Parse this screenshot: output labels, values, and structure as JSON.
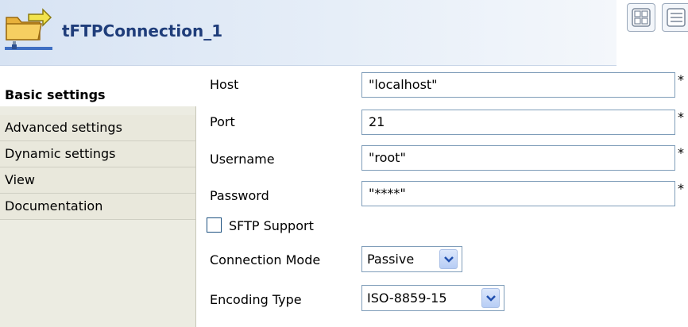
{
  "header": {
    "title": "tFTPConnection_1",
    "icon": "ftp-connection-folder-icon",
    "layout_buttons": [
      "grid-layout-icon",
      "list-layout-icon"
    ]
  },
  "sidebar": {
    "items": [
      {
        "label": "Basic settings",
        "active": true
      },
      {
        "label": "Advanced settings",
        "active": false
      },
      {
        "label": "Dynamic settings",
        "active": false
      },
      {
        "label": "View",
        "active": false
      },
      {
        "label": "Documentation",
        "active": false
      }
    ]
  },
  "form": {
    "host": {
      "label": "Host",
      "value": "\"localhost\"",
      "required_mark": "*"
    },
    "port": {
      "label": "Port",
      "value": "21",
      "required_mark": "*"
    },
    "username": {
      "label": "Username",
      "value": "\"root\"",
      "required_mark": "*"
    },
    "password": {
      "label": "Password",
      "value": "\"****\"",
      "required_mark": "*"
    },
    "sftp_support": {
      "label": "SFTP Support",
      "checked": false
    },
    "connection_mode": {
      "label": "Connection Mode",
      "value": "Passive"
    },
    "encoding_type": {
      "label": "Encoding Type",
      "value": "ISO-8859-15"
    }
  },
  "colors": {
    "header_title": "#1f3d7a",
    "sidebar_bg": "#ecece2",
    "field_border": "#7f9db9",
    "dropdown_arrow": "#1f4fae"
  }
}
